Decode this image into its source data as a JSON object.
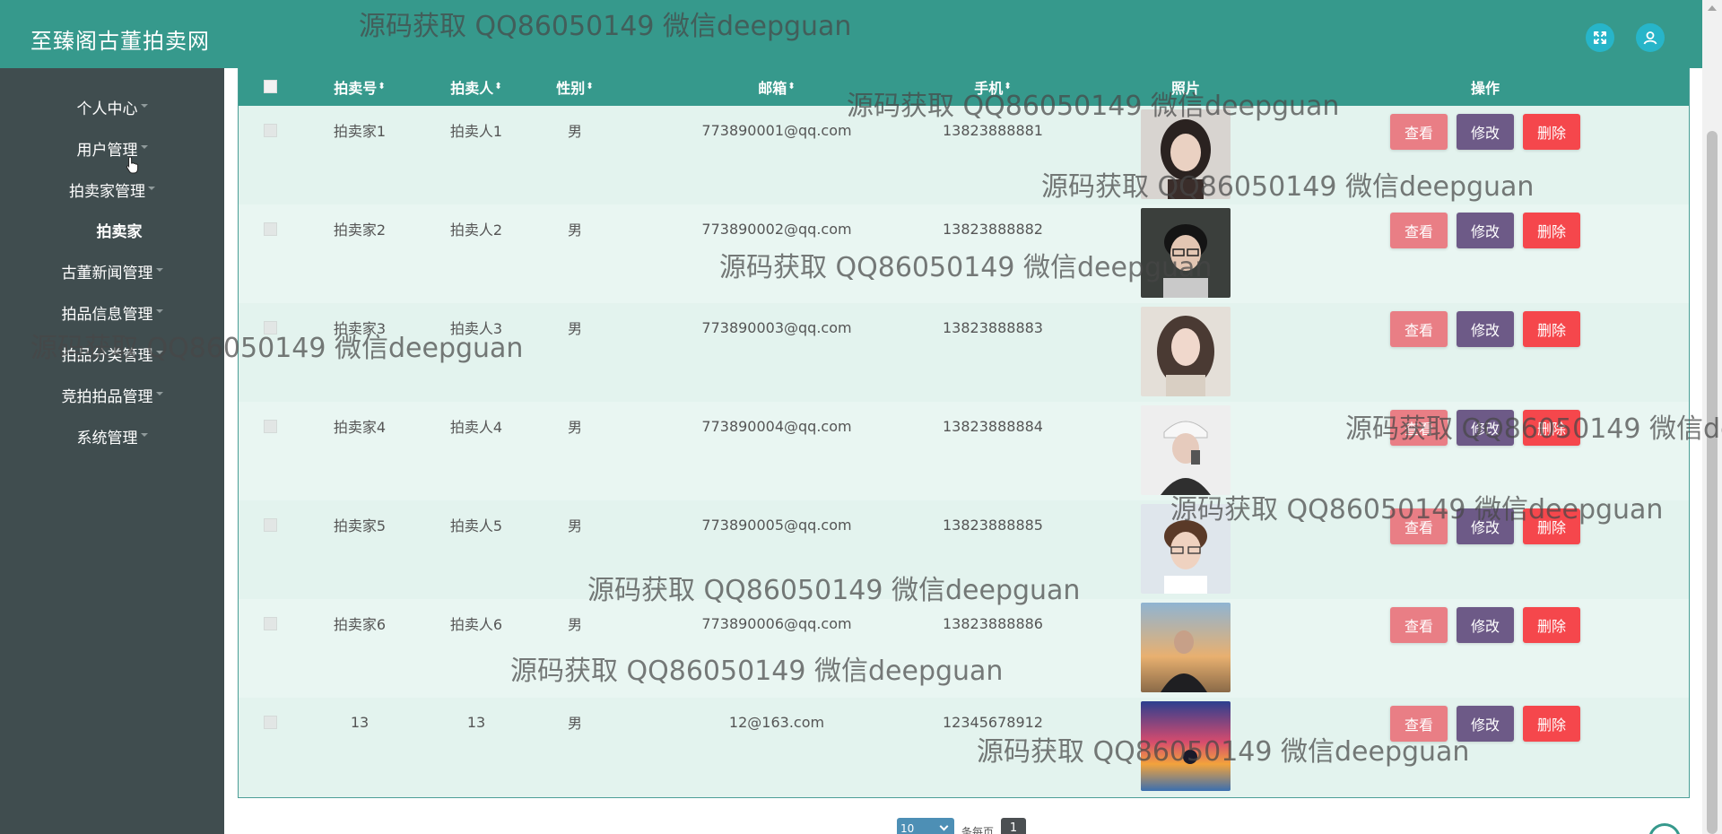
{
  "app": {
    "title": "至臻阁古董拍卖网"
  },
  "sidebar": {
    "items": [
      {
        "label": "个人中心",
        "has_caret": true
      },
      {
        "label": "用户管理",
        "has_caret": true
      },
      {
        "label": "拍卖家管理",
        "has_caret": true
      },
      {
        "label": "拍卖家",
        "has_caret": false,
        "active": true
      },
      {
        "label": "古董新闻管理",
        "has_caret": true
      },
      {
        "label": "拍品信息管理",
        "has_caret": true
      },
      {
        "label": "拍品分类管理",
        "has_caret": true
      },
      {
        "label": "竞拍拍品管理",
        "has_caret": true
      },
      {
        "label": "系统管理",
        "has_caret": true
      }
    ]
  },
  "table": {
    "columns": [
      "拍卖号",
      "拍卖人",
      "性别",
      "邮箱",
      "手机",
      "照片",
      "操作"
    ],
    "rows": [
      {
        "id": "拍卖家1",
        "name": "拍卖人1",
        "gender": "男",
        "email": "773890001@qq.com",
        "phone": "13823888881"
      },
      {
        "id": "拍卖家2",
        "name": "拍卖人2",
        "gender": "男",
        "email": "773890002@qq.com",
        "phone": "13823888882"
      },
      {
        "id": "拍卖家3",
        "name": "拍卖人3",
        "gender": "男",
        "email": "773890003@qq.com",
        "phone": "13823888883"
      },
      {
        "id": "拍卖家4",
        "name": "拍卖人4",
        "gender": "男",
        "email": "773890004@qq.com",
        "phone": "13823888884"
      },
      {
        "id": "拍卖家5",
        "name": "拍卖人5",
        "gender": "男",
        "email": "773890005@qq.com",
        "phone": "13823888885"
      },
      {
        "id": "拍卖家6",
        "name": "拍卖人6",
        "gender": "男",
        "email": "773890006@qq.com",
        "phone": "13823888886"
      },
      {
        "id": "13",
        "name": "13",
        "gender": "男",
        "email": "12@163.com",
        "phone": "12345678912"
      }
    ],
    "actions": {
      "view": "查看",
      "edit": "修改",
      "delete": "删除"
    }
  },
  "pagination": {
    "page_size": "10",
    "per_page_label": "条每页",
    "current_page": "1"
  },
  "watermark": {
    "text": "源码获取 QQ86050149 微信deepguan"
  },
  "icons": {
    "fullscreen": "fullscreen-icon",
    "user": "user-icon",
    "sort": "sort-icon",
    "cursor": "hand-cursor-icon"
  },
  "colors": {
    "header": "#36998c",
    "sidebar": "#404d4f",
    "view_button": "#e97e85",
    "edit_button": "#6d5a87",
    "delete_button": "#f5474c"
  }
}
